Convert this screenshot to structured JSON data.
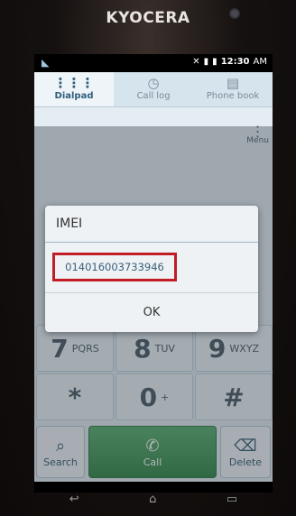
{
  "device": {
    "brand": "KYOCERA"
  },
  "status_bar": {
    "time": "12:30",
    "ampm": "AM"
  },
  "tabs": [
    {
      "label": "Dialpad",
      "icon": "dialpad-icon"
    },
    {
      "label": "Call log",
      "icon": "call-log-icon"
    },
    {
      "label": "Phone book",
      "icon": "phone-book-icon"
    }
  ],
  "menu": {
    "label": "Menu"
  },
  "keypad": {
    "keys": [
      {
        "digit": "7",
        "letters": "PQRS"
      },
      {
        "digit": "8",
        "letters": "TUV"
      },
      {
        "digit": "9",
        "letters": "WXYZ"
      },
      {
        "digit": "*",
        "letters": ""
      },
      {
        "digit": "0",
        "letters": "+"
      },
      {
        "digit": "#",
        "letters": ""
      }
    ]
  },
  "bottom_bar": {
    "search_label": "Search",
    "call_label": "Call",
    "delete_label": "Delete"
  },
  "dialog": {
    "title": "IMEI",
    "imei_value": "014016003733946",
    "ok_label": "OK",
    "highlight_color": "#c11d24"
  },
  "colors": {
    "call_button": "#4ea261",
    "active_tab_text": "#2f5d7d"
  }
}
